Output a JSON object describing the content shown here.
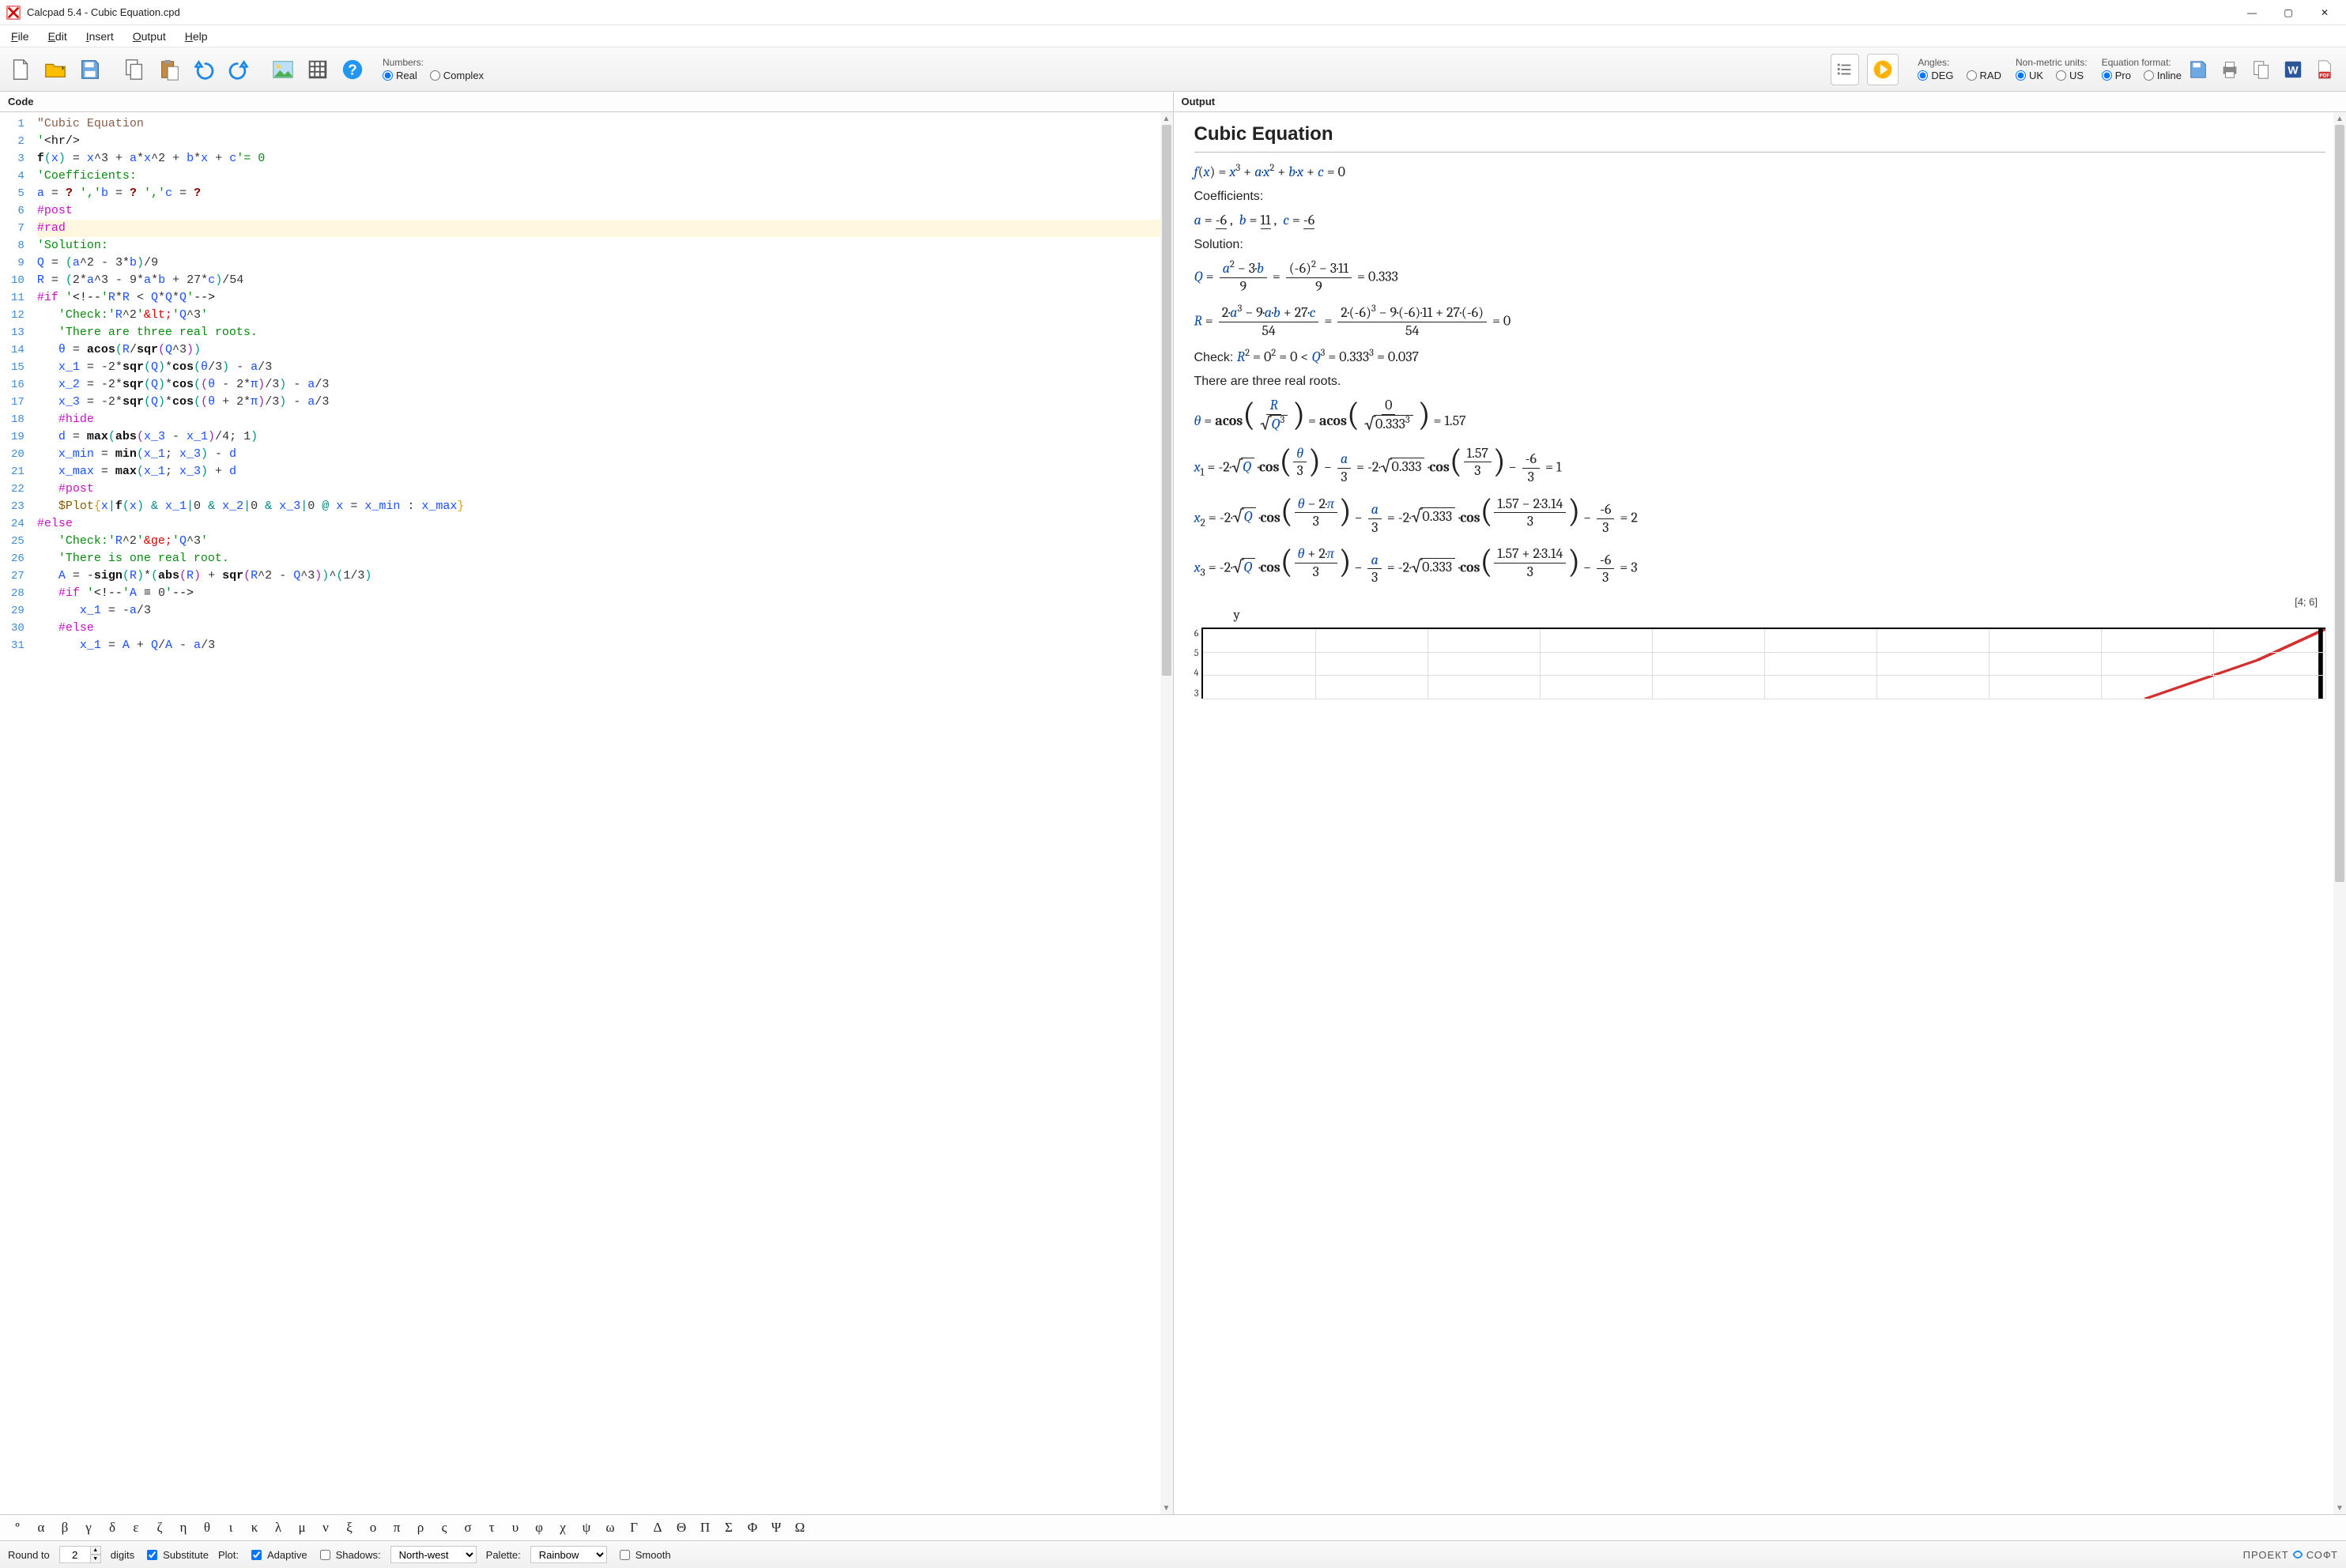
{
  "window": {
    "title": "Calcpad 5.4 - Cubic Equation.cpd"
  },
  "menu": {
    "file": "File",
    "edit": "Edit",
    "insert": "Insert",
    "output": "Output",
    "help": "Help"
  },
  "toolbar": {
    "numbers_label": "Numbers:",
    "real": "Real",
    "complex": "Complex",
    "angles_label": "Angles:",
    "deg": "DEG",
    "rad": "RAD",
    "units_label": "Non-metric units:",
    "uk": "UK",
    "us": "US",
    "eqfmt_label": "Equation format:",
    "pro": "Pro",
    "inline": "Inline"
  },
  "panes": {
    "code": "Code",
    "output": "Output"
  },
  "code_lines": [
    {
      "n": 1,
      "html": "<span class='tok-str'>\"Cubic Equation</span>"
    },
    {
      "n": 2,
      "html": "<span class='tok-com'>'</span><span class='tok-tag'>&lt;hr/&gt;</span>"
    },
    {
      "n": 3,
      "html": "<span class='tok-fn'>f</span><span class='tok-paren'>(</span><span class='tok-var'>x</span><span class='tok-paren'>)</span> <span class='tok-op'>=</span> <span class='tok-var'>x</span><span class='tok-op'>^</span><span class='tok-num'>3</span> <span class='tok-op'>+</span> <span class='tok-var'>a</span><span class='tok-op'>*</span><span class='tok-var'>x</span><span class='tok-op'>^</span><span class='tok-num'>2</span> <span class='tok-op'>+</span> <span class='tok-var'>b</span><span class='tok-op'>*</span><span class='tok-var'>x</span> <span class='tok-op'>+</span> <span class='tok-var'>c</span><span class='tok-com'>'= 0</span>"
    },
    {
      "n": 4,
      "html": "<span class='tok-com'>'Coefficients:</span>"
    },
    {
      "n": 5,
      "html": "<span class='tok-var'>a</span> <span class='tok-op'>=</span> <span class='tok-qm'>?</span> <span class='tok-com'>',</span><span class='tok-com'>'</span><span class='tok-var'>b</span> <span class='tok-op'>=</span> <span class='tok-qm'>?</span> <span class='tok-com'>',</span><span class='tok-com'>'</span><span class='tok-var'>c</span> <span class='tok-op'>=</span> <span class='tok-qm'>?</span>"
    },
    {
      "n": 6,
      "html": "<span class='tok-dir'>#post</span>"
    },
    {
      "n": 7,
      "html": "<span class='tok-dir'>#rad</span>",
      "hl": true
    },
    {
      "n": 8,
      "html": "<span class='tok-com'>'Solution:</span>"
    },
    {
      "n": 9,
      "html": "<span class='tok-var'>Q</span> <span class='tok-op'>=</span> <span class='tok-paren'>(</span><span class='tok-var'>a</span><span class='tok-op'>^</span><span class='tok-num'>2</span> <span class='tok-op'>-</span> <span class='tok-num'>3</span><span class='tok-op'>*</span><span class='tok-var'>b</span><span class='tok-paren'>)</span><span class='tok-op'>/</span><span class='tok-num'>9</span>"
    },
    {
      "n": 10,
      "html": "<span class='tok-var'>R</span> <span class='tok-op'>=</span> <span class='tok-paren'>(</span><span class='tok-num'>2</span><span class='tok-op'>*</span><span class='tok-var'>a</span><span class='tok-op'>^</span><span class='tok-num'>3</span> <span class='tok-op'>-</span> <span class='tok-num'>9</span><span class='tok-op'>*</span><span class='tok-var'>a</span><span class='tok-op'>*</span><span class='tok-var'>b</span> <span class='tok-op'>+</span> <span class='tok-num'>27</span><span class='tok-op'>*</span><span class='tok-var'>c</span><span class='tok-paren'>)</span><span class='tok-op'>/</span><span class='tok-num'>54</span>"
    },
    {
      "n": 11,
      "html": "<span class='tok-dir'>#if</span> <span class='tok-com'>'</span><span class='tok-tag'>&lt;!--</span><span class='tok-com'>'</span><span class='tok-var'>R</span><span class='tok-op'>*</span><span class='tok-var'>R</span> <span class='tok-op'>&lt;</span> <span class='tok-var'>Q</span><span class='tok-op'>*</span><span class='tok-var'>Q</span><span class='tok-op'>*</span><span class='tok-var'>Q</span><span class='tok-com'>'</span><span class='tok-tag'>--&gt;</span>"
    },
    {
      "n": 12,
      "html": "   <span class='tok-com'>'Check:'</span><span class='tok-var'>R</span><span class='tok-op'>^</span><span class='tok-num'>2</span><span class='tok-com'>'</span><span class='tok-red'>&amp;lt;</span><span class='tok-com'>'</span><span class='tok-var'>Q</span><span class='tok-op'>^</span><span class='tok-num'>3</span><span class='tok-com'>'</span>"
    },
    {
      "n": 13,
      "html": "   <span class='tok-com'>'There are three real roots.</span>"
    },
    {
      "n": 14,
      "html": "   <span class='tok-var'>θ</span> <span class='tok-op'>=</span> <span class='tok-fn'>acos</span><span class='tok-paren'>(</span><span class='tok-var'>R</span><span class='tok-op'>/</span><span class='tok-fn'>sqr</span><span class='tok-par2'>(</span><span class='tok-var'>Q</span><span class='tok-op'>^</span><span class='tok-num'>3</span><span class='tok-par2'>)</span><span class='tok-paren'>)</span>"
    },
    {
      "n": 15,
      "html": "   <span class='tok-var'>x_1</span> <span class='tok-op'>=</span> <span class='tok-op'>-</span><span class='tok-num'>2</span><span class='tok-op'>*</span><span class='tok-fn'>sqr</span><span class='tok-paren'>(</span><span class='tok-var'>Q</span><span class='tok-paren'>)</span><span class='tok-op'>*</span><span class='tok-fn'>cos</span><span class='tok-paren'>(</span><span class='tok-var'>θ</span><span class='tok-op'>/</span><span class='tok-num'>3</span><span class='tok-paren'>)</span> <span class='tok-op'>-</span> <span class='tok-var'>a</span><span class='tok-op'>/</span><span class='tok-num'>3</span>"
    },
    {
      "n": 16,
      "html": "   <span class='tok-var'>x_2</span> <span class='tok-op'>=</span> <span class='tok-op'>-</span><span class='tok-num'>2</span><span class='tok-op'>*</span><span class='tok-fn'>sqr</span><span class='tok-paren'>(</span><span class='tok-var'>Q</span><span class='tok-paren'>)</span><span class='tok-op'>*</span><span class='tok-fn'>cos</span><span class='tok-paren'>(</span><span class='tok-par2'>(</span><span class='tok-var'>θ</span> <span class='tok-op'>-</span> <span class='tok-num'>2</span><span class='tok-op'>*</span><span class='tok-var'>π</span><span class='tok-par2'>)</span><span class='tok-op'>/</span><span class='tok-num'>3</span><span class='tok-paren'>)</span> <span class='tok-op'>-</span> <span class='tok-var'>a</span><span class='tok-op'>/</span><span class='tok-num'>3</span>"
    },
    {
      "n": 17,
      "html": "   <span class='tok-var'>x_3</span> <span class='tok-op'>=</span> <span class='tok-op'>-</span><span class='tok-num'>2</span><span class='tok-op'>*</span><span class='tok-fn'>sqr</span><span class='tok-paren'>(</span><span class='tok-var'>Q</span><span class='tok-paren'>)</span><span class='tok-op'>*</span><span class='tok-fn'>cos</span><span class='tok-paren'>(</span><span class='tok-par2'>(</span><span class='tok-var'>θ</span> <span class='tok-op'>+</span> <span class='tok-num'>2</span><span class='tok-op'>*</span><span class='tok-var'>π</span><span class='tok-par2'>)</span><span class='tok-op'>/</span><span class='tok-num'>3</span><span class='tok-paren'>)</span> <span class='tok-op'>-</span> <span class='tok-var'>a</span><span class='tok-op'>/</span><span class='tok-num'>3</span>"
    },
    {
      "n": 18,
      "html": "   <span class='tok-dir'>#hide</span>"
    },
    {
      "n": 19,
      "html": "   <span class='tok-var'>d</span> <span class='tok-op'>=</span> <span class='tok-fn'>max</span><span class='tok-paren'>(</span><span class='tok-fn'>abs</span><span class='tok-par2'>(</span><span class='tok-var'>x_3</span> <span class='tok-op'>-</span> <span class='tok-var'>x_1</span><span class='tok-par2'>)</span><span class='tok-op'>/</span><span class='tok-num'>4</span><span class='tok-sep'>;</span> <span class='tok-num'>1</span><span class='tok-paren'>)</span>"
    },
    {
      "n": 20,
      "html": "   <span class='tok-var'>x_min</span> <span class='tok-op'>=</span> <span class='tok-fn'>min</span><span class='tok-paren'>(</span><span class='tok-var'>x_1</span><span class='tok-sep'>;</span> <span class='tok-var'>x_3</span><span class='tok-paren'>)</span> <span class='tok-op'>-</span> <span class='tok-var'>d</span>"
    },
    {
      "n": 21,
      "html": "   <span class='tok-var'>x_max</span> <span class='tok-op'>=</span> <span class='tok-fn'>max</span><span class='tok-paren'>(</span><span class='tok-var'>x_1</span><span class='tok-sep'>;</span> <span class='tok-var'>x_3</span><span class='tok-paren'>)</span> <span class='tok-op'>+</span> <span class='tok-var'>d</span>"
    },
    {
      "n": 22,
      "html": "   <span class='tok-dir'>#post</span>"
    },
    {
      "n": 23,
      "html": "   <span class='tok-pragma'>$Plot</span><span class='tok-par3'>{</span><span class='tok-var'>x</span><span class='tok-cyan'>|</span><span class='tok-fn'>f</span><span class='tok-paren'>(</span><span class='tok-var'>x</span><span class='tok-paren'>)</span> <span class='tok-cyan'>&amp;</span> <span class='tok-var'>x_1</span><span class='tok-cyan'>|</span><span class='tok-num'>0</span> <span class='tok-cyan'>&amp;</span> <span class='tok-var'>x_2</span><span class='tok-cyan'>|</span><span class='tok-num'>0</span> <span class='tok-cyan'>&amp;</span> <span class='tok-var'>x_3</span><span class='tok-cyan'>|</span><span class='tok-num'>0</span> <span class='tok-cyan'>@</span> <span class='tok-var'>x</span> <span class='tok-op'>=</span> <span class='tok-var'>x_min</span> <span class='tok-sep'>:</span> <span class='tok-var'>x_max</span><span class='tok-par3'>}</span>"
    },
    {
      "n": 24,
      "html": "<span class='tok-dir'>#else</span>"
    },
    {
      "n": 25,
      "html": "   <span class='tok-com'>'Check:'</span><span class='tok-var'>R</span><span class='tok-op'>^</span><span class='tok-num'>2</span><span class='tok-com'>'</span><span class='tok-red'>&amp;ge;</span><span class='tok-com'>'</span><span class='tok-var'>Q</span><span class='tok-op'>^</span><span class='tok-num'>3</span><span class='tok-com'>'</span>"
    },
    {
      "n": 26,
      "html": "   <span class='tok-com'>'There is one real root.</span>"
    },
    {
      "n": 27,
      "html": "   <span class='tok-var'>A</span> <span class='tok-op'>=</span> <span class='tok-op'>-</span><span class='tok-fn'>sign</span><span class='tok-paren'>(</span><span class='tok-var'>R</span><span class='tok-paren'>)</span><span class='tok-op'>*</span><span class='tok-paren'>(</span><span class='tok-fn'>abs</span><span class='tok-par2'>(</span><span class='tok-var'>R</span><span class='tok-par2'>)</span> <span class='tok-op'>+</span> <span class='tok-fn'>sqr</span><span class='tok-par2'>(</span><span class='tok-var'>R</span><span class='tok-op'>^</span><span class='tok-num'>2</span> <span class='tok-op'>-</span> <span class='tok-var'>Q</span><span class='tok-op'>^</span><span class='tok-num'>3</span><span class='tok-par2'>)</span><span class='tok-paren'>)</span><span class='tok-op'>^</span><span class='tok-paren'>(</span><span class='tok-num'>1</span><span class='tok-op'>/</span><span class='tok-num'>3</span><span class='tok-paren'>)</span>"
    },
    {
      "n": 28,
      "html": "   <span class='tok-dir'>#if</span> <span class='tok-com'>'</span><span class='tok-tag'>&lt;!--</span><span class='tok-com'>'</span><span class='tok-var'>A</span> <span class='tok-op'>≡</span> <span class='tok-num'>0</span><span class='tok-com'>'</span><span class='tok-tag'>--&gt;</span>"
    },
    {
      "n": 29,
      "html": "      <span class='tok-var'>x_1</span> <span class='tok-op'>=</span> <span class='tok-op'>-</span><span class='tok-var'>a</span><span class='tok-op'>/</span><span class='tok-num'>3</span>"
    },
    {
      "n": 30,
      "html": "   <span class='tok-dir'>#else</span>"
    },
    {
      "n": 31,
      "html": "      <span class='tok-var'>x_1</span> <span class='tok-op'>=</span> <span class='tok-var'>A</span> <span class='tok-op'>+</span> <span class='tok-var'>Q</span><span class='tok-op'>/</span><span class='tok-var'>A</span> <span class='tok-op'>-</span> <span class='tok-var'>a</span><span class='tok-op'>/</span><span class='tok-num'>3</span>"
    }
  ],
  "output": {
    "title": "Cubic Equation",
    "coeff_label": "Coefficients:",
    "sol_label": "Solution:",
    "check_label": "Check: ",
    "three_roots": "There are three real roots.",
    "a": "-6",
    "b": "11",
    "c": "-6",
    "Q": "0.333",
    "R": "0",
    "check_r2": "0",
    "check_q3_v": "0.333",
    "check_q3": "0.037",
    "theta": "1.57",
    "x1": "1",
    "x2": "2",
    "x3": "3",
    "coord": "[4; 6]"
  },
  "chart_data": {
    "type": "line",
    "title": "",
    "xlabel": "",
    "ylabel": "y",
    "xlim": [
      0,
      4
    ],
    "ylim": [
      3,
      6
    ],
    "y_ticks": [
      6,
      5,
      4,
      3
    ],
    "note": "partial cubic plot visible; red curve rising steeply toward x≈4, y≈6"
  },
  "greek": [
    "°",
    "α",
    "β",
    "γ",
    "δ",
    "ε",
    "ζ",
    "η",
    "θ",
    "ι",
    "κ",
    "λ",
    "μ",
    "ν",
    "ξ",
    "ο",
    "π",
    "ρ",
    "ς",
    "σ",
    "τ",
    "υ",
    "φ",
    "χ",
    "ψ",
    "ω",
    "Γ",
    "Δ",
    "Θ",
    "Π",
    "Σ",
    "Φ",
    "Ψ",
    "Ω"
  ],
  "status": {
    "round_label": "Round to",
    "round_val": "2",
    "digits": "digits",
    "substitute": "Substitute",
    "plot_label": "Plot:",
    "adaptive": "Adaptive",
    "shadows": "Shadows:",
    "direction": "North-west",
    "palette_label": "Palette:",
    "palette": "Rainbow",
    "smooth": "Smooth",
    "brand1": "ПРОЕКТ",
    "brand2": "СОФТ"
  }
}
